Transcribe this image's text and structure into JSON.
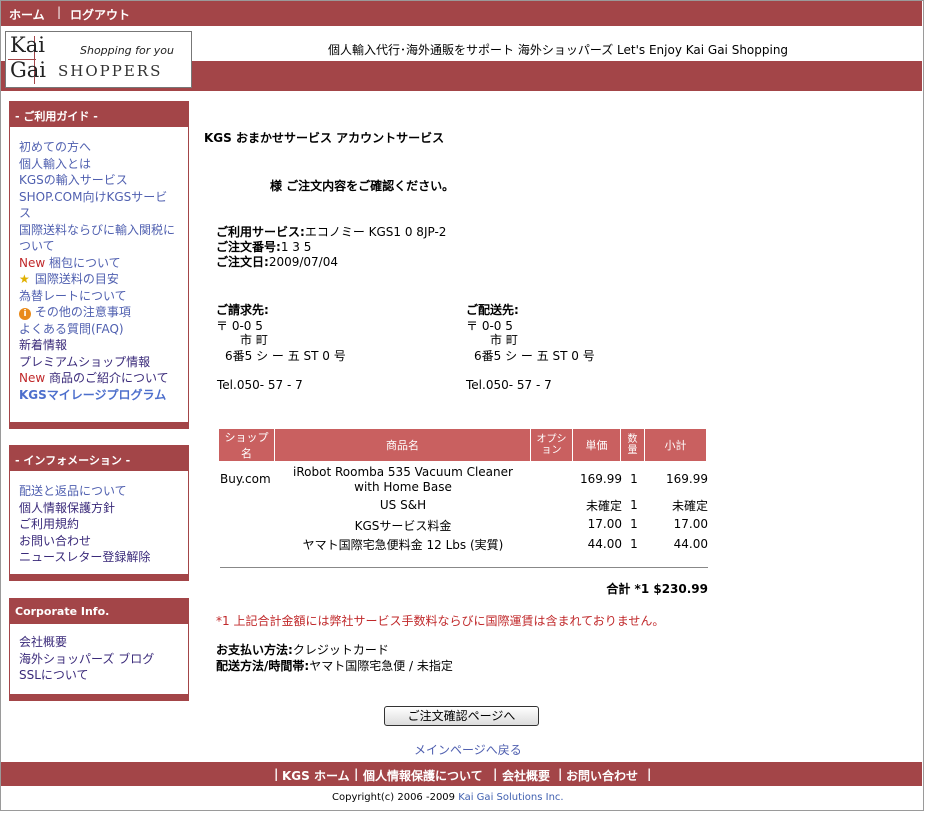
{
  "topbar": {
    "home": "ホーム",
    "separator": "|",
    "logout": "ログアウト"
  },
  "logo": {
    "kai": "Kai",
    "gai": "Gai",
    "shopping_for_you": "Shopping for you",
    "shoppers": "SHOPPERS"
  },
  "header": {
    "tagline": "個人輸入代行･海外通販をサポート  海外ショッパーズ  Let's Enjoy Kai Gai Shopping"
  },
  "sidebar": {
    "guide": {
      "title": "- ご利用ガイド -",
      "items": [
        {
          "label": "初めての方へ"
        },
        {
          "label": "個人輸入とは"
        },
        {
          "label": "KGSの輸入サービス"
        },
        {
          "label": "SHOP.COM向けKGSサービ"
        },
        {
          "label": "ス"
        },
        {
          "label": "国際送料ならびに輸入関税に"
        },
        {
          "label": "ついて"
        },
        {
          "prefix": "New",
          "label": " 梱包について"
        },
        {
          "label": " 国際送料の目安",
          "icon": "star-icon"
        },
        {
          "label": "為替レートについて"
        },
        {
          "label": " その他の注意事項",
          "icon": "info-icon"
        },
        {
          "label": "よくある質問(FAQ)"
        },
        {
          "label": "新着情報"
        },
        {
          "label": "プレミアムショップ情報"
        },
        {
          "prefix": "New",
          "label": " 商品のご紹介について"
        },
        {
          "label": "KGSマイレージプログラム"
        }
      ]
    },
    "info": {
      "title": "- インフォメーション -",
      "items": [
        "配送と返品について",
        "個人情報保護方針",
        "ご利用規約",
        "お問い合わせ",
        "ニュースレター登録解除"
      ]
    },
    "corporate": {
      "title": "Corporate Info.",
      "items": [
        "会社概要",
        "海外ショッパーズ  ブログ",
        "SSLについて"
      ]
    }
  },
  "main": {
    "title": "KGS おまかせサービス  アカウントサービス",
    "greeting": "様  ご注文内容をご確認ください。",
    "service_label": "ご利用サービス:",
    "service_value": "エコノミー  KGS1  0  8JP-2",
    "order_no_label": "ご注文番号:",
    "order_no_value": "1    3  5",
    "order_date_label": "ご注文日:",
    "order_date_value": "2009/07/04",
    "billing": {
      "label": "ご請求先:",
      "line1": "〒     0-0    5",
      "line2": "市      町",
      "line3": "6番5          シ    ー    五          ST    0   号",
      "tel": "Tel.050-   57  -  7"
    },
    "shipping": {
      "label": "ご配送先:",
      "line1": "〒     0-0    5",
      "line2": "市      町",
      "line3": "6番5          シ    ー    五          ST    0   号",
      "tel": "Tel.050-   57  -  7"
    },
    "table": {
      "headers": [
        "ショップ名",
        "商品名",
        "オプション",
        "単価",
        "数量",
        "小計"
      ],
      "rows": [
        {
          "shop": "Buy.com",
          "item": "iRobot Roomba 535 Vacuum Cleaner",
          "item2": "with Home Base",
          "price": "169.99",
          "qty": "1",
          "subtotal": "169.99"
        },
        {
          "shop": "",
          "item": "US S&H",
          "item2": "",
          "price": "未確定",
          "qty": "1",
          "subtotal": "未確定"
        },
        {
          "shop": "",
          "item": "KGSサービス料金",
          "item2": "",
          "price": "17.00",
          "qty": "1",
          "subtotal": "17.00"
        },
        {
          "shop": "",
          "item": "ヤマト国際宅急便料金 12 Lbs (実質)",
          "item2": "",
          "price": "44.00",
          "qty": "1",
          "subtotal": "44.00"
        }
      ]
    },
    "total_label": "合計  *1 $230.99",
    "note": "*1 上記合計金額には弊社サービス手数料ならびに国際運賃は含まれておりません。",
    "payment_label": "お支払い方法:",
    "payment_value": "クレジットカード",
    "delivery_label": "配送方法/時間帯:",
    "delivery_value": "ヤマト国際宅急便 / 未指定",
    "confirm_button": "ご注文確認ページへ",
    "back_link": "メインページへ戻る"
  },
  "footer": {
    "links": [
      "KGS ホーム",
      "個人情報保護について",
      "会社概要",
      "お問い合わせ"
    ],
    "separator": "|",
    "copyright": "Copyright(c) 2006 -2009 ",
    "company": "Kai Gai Solutions Inc."
  },
  "colors": {
    "brand": "#a34548",
    "table_header": "#c96060",
    "link": "#5060b0",
    "new": "#c0282a",
    "note": "#c0282a"
  }
}
